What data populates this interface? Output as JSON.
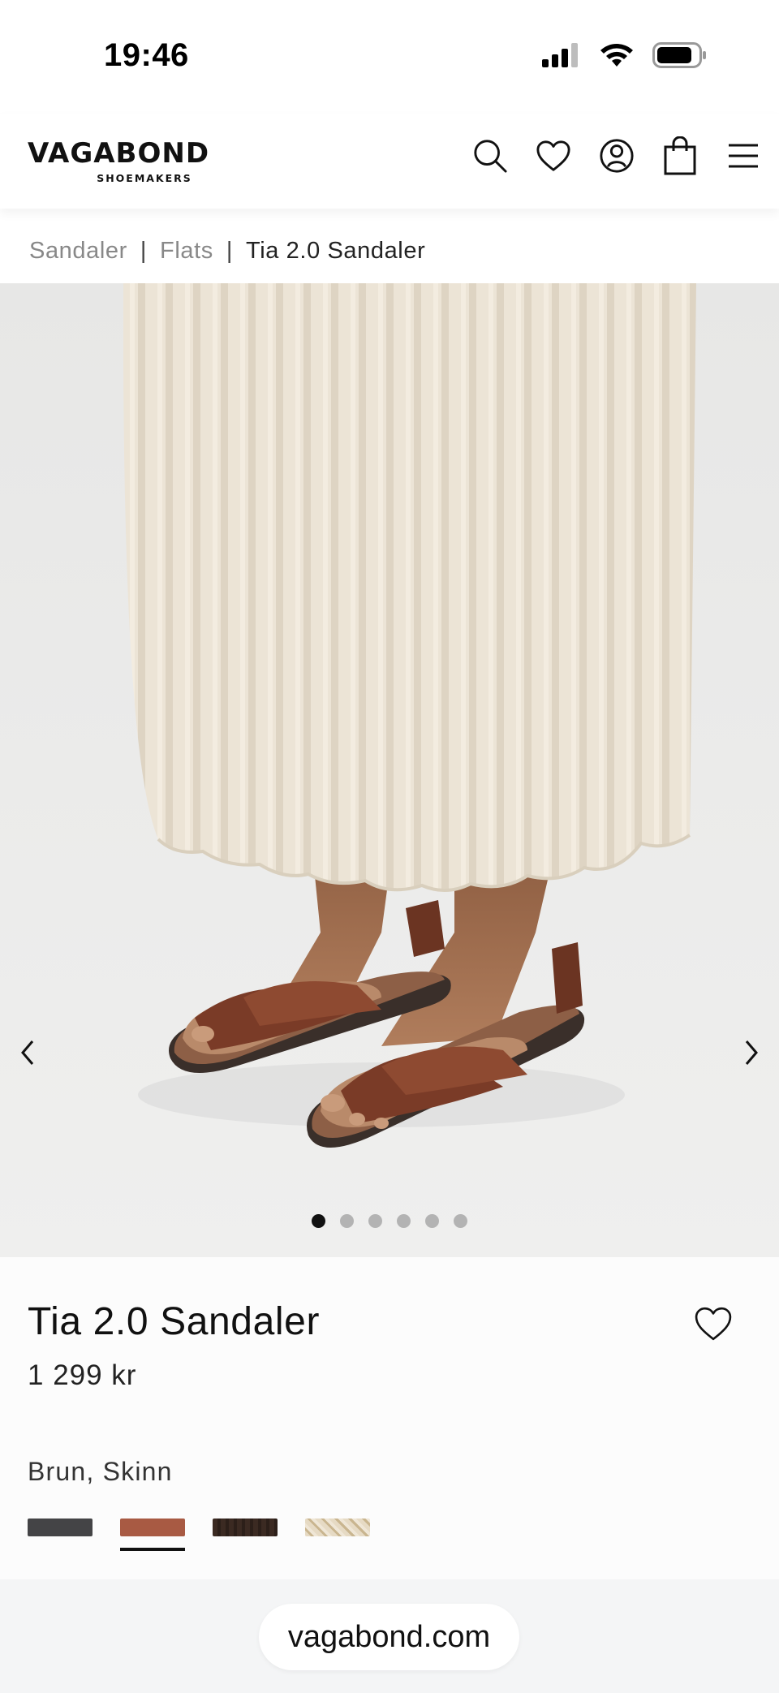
{
  "status_bar": {
    "time": "19:46"
  },
  "header": {
    "logo_main": "VAGABOND",
    "logo_sub": "SHOEMAKERS",
    "icons": [
      "search-icon",
      "heart-icon",
      "user-icon",
      "bag-icon",
      "menu-icon"
    ]
  },
  "breadcrumb": {
    "items": [
      "Sandaler",
      "Flats"
    ],
    "current": "Tia 2.0 Sandaler",
    "separator": "|"
  },
  "gallery": {
    "image_count": 6,
    "active_index": 0,
    "prev_icon": "chevron-left-icon",
    "next_icon": "chevron-right-icon"
  },
  "product": {
    "title": "Tia 2.0 Sandaler",
    "price": "1 299 kr",
    "color_label": "Brun, Skinn",
    "swatches": [
      {
        "name": "dark-grey",
        "color": "#444446",
        "selected": false
      },
      {
        "name": "brown",
        "color": "#a85a43",
        "selected": true
      },
      {
        "name": "dark-brown",
        "color": "#3b2a22",
        "selected": false
      },
      {
        "name": "leopard",
        "color": "#d8c9ae",
        "selected": false
      }
    ]
  },
  "browser": {
    "url": "vagabond.com"
  },
  "colors": {
    "accent": "#111111",
    "gallery_bg": "#ececeb",
    "skirt": "#e9e1d3",
    "sandal": "#7a3b27"
  }
}
